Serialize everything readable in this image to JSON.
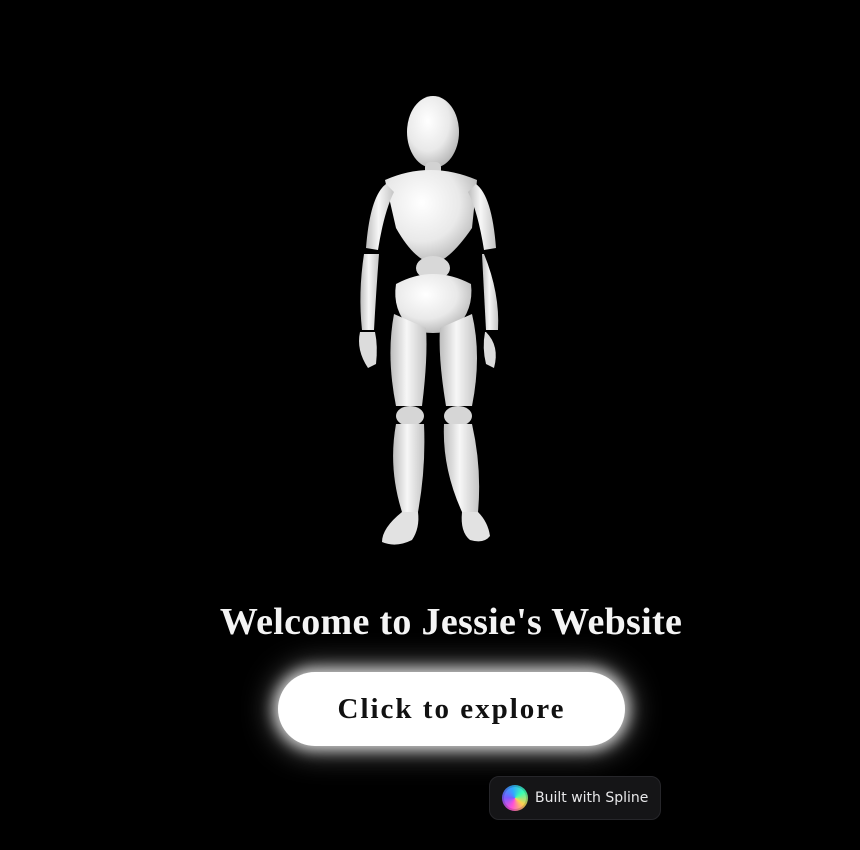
{
  "hero": {
    "title": "Welcome to Jessie's Website",
    "figure_icon": "mannequin-figure"
  },
  "cta": {
    "label": "Click to explore"
  },
  "badge": {
    "label": "Built with Spline",
    "icon": "spline-logo-icon"
  },
  "colors": {
    "background": "#000000",
    "title": "#f4f4f4",
    "button_bg": "#ffffff",
    "button_text": "#111111",
    "badge_bg": "#151517"
  }
}
